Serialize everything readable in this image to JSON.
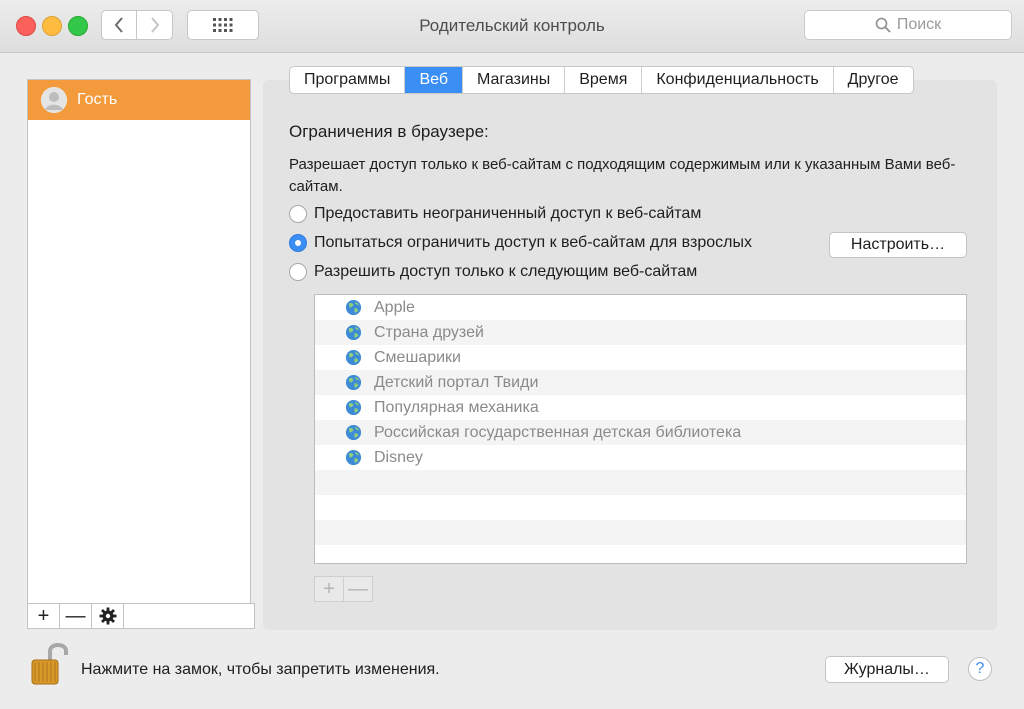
{
  "window": {
    "title": "Родительский контроль",
    "search_placeholder": "Поиск"
  },
  "sidebar": {
    "users": [
      {
        "label": "Гость",
        "selected": true
      }
    ],
    "toolbar": {
      "add": "+",
      "remove": "—",
      "gear_icon": "gear-icon"
    }
  },
  "tabs": [
    {
      "label": "Программы",
      "active": false
    },
    {
      "label": "Веб",
      "active": true
    },
    {
      "label": "Магазины",
      "active": false
    },
    {
      "label": "Время",
      "active": false
    },
    {
      "label": "Конфиденциальность",
      "active": false
    },
    {
      "label": "Другое",
      "active": false
    }
  ],
  "web": {
    "section_title": "Ограничения в браузере:",
    "description": "Разрешает доступ только к веб-сайтам с подходящим содержимым или к указанным Вами веб-сайтам.",
    "options": [
      {
        "label": "Предоставить неограниченный доступ к веб-сайтам",
        "checked": false
      },
      {
        "label": "Попытаться ограничить доступ к веб-сайтам для взрослых",
        "checked": true
      },
      {
        "label": "Разрешить доступ только к следующим веб-сайтам",
        "checked": false
      }
    ],
    "configure_button": "Настроить…",
    "sites": [
      "Apple",
      "Страна друзей",
      "Смешарики",
      "Детский портал Твиди",
      "Популярная механика",
      "Российская государственная детская библиотека",
      "Disney"
    ],
    "list_add": "+",
    "list_remove": "—"
  },
  "footer": {
    "lock_text": "Нажмите на замок, чтобы запретить изменения.",
    "logs_button": "Журналы…",
    "help": "?"
  },
  "colors": {
    "accent": "#3b8ef3",
    "selection": "#f39a3c"
  }
}
